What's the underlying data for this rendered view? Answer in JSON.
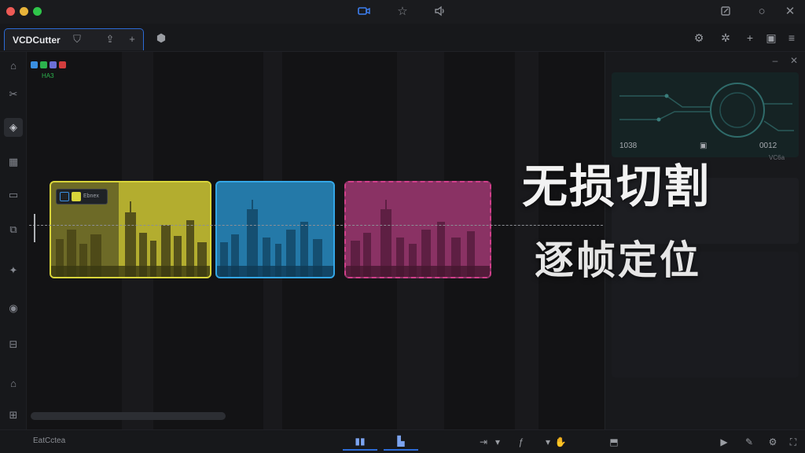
{
  "app": {
    "tab_title": "VCDCutter"
  },
  "canvas": {
    "clip_tag_text": "Ebnex",
    "mini_label": "HA3"
  },
  "right_panel": {
    "stat_left": "1038",
    "stat_right": "0012",
    "sub_right": "VC6a"
  },
  "overlay": {
    "headline": "无损切割",
    "subline": "逐帧定位"
  },
  "bottom": {
    "status_text": "EatCctea"
  },
  "colors": {
    "clip_yellow": "#d8d43a",
    "clip_blue": "#33a6e6",
    "clip_pink": "#d03f8a",
    "accent": "#2c6bd6"
  }
}
